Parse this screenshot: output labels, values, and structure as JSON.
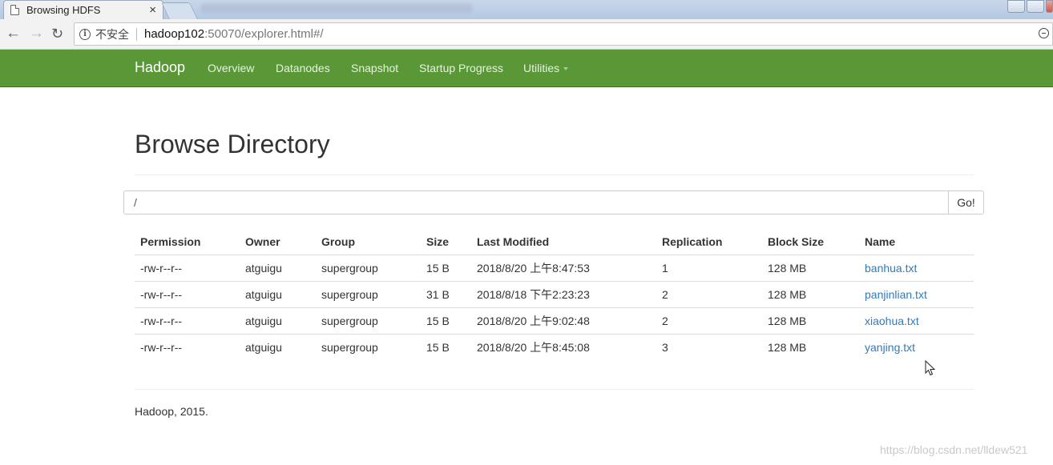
{
  "browser": {
    "tab_title": "Browsing HDFS",
    "tab_close": "×",
    "insecure_label": "不安全",
    "url_host": "hadoop102",
    "url_rest": ":50070/explorer.html#/"
  },
  "navbar": {
    "brand": "Hadoop",
    "items": [
      "Overview",
      "Datanodes",
      "Snapshot",
      "Startup Progress",
      "Utilities"
    ]
  },
  "page": {
    "title": "Browse Directory",
    "path_value": "/",
    "go_label": "Go!"
  },
  "table": {
    "headers": [
      "Permission",
      "Owner",
      "Group",
      "Size",
      "Last Modified",
      "Replication",
      "Block Size",
      "Name"
    ],
    "rows": [
      [
        "-rw-r--r--",
        "atguigu",
        "supergroup",
        "15 B",
        "2018/8/20 上午8:47:53",
        "1",
        "128 MB",
        "banhua.txt"
      ],
      [
        "-rw-r--r--",
        "atguigu",
        "supergroup",
        "31 B",
        "2018/8/18 下午2:23:23",
        "2",
        "128 MB",
        "panjinlian.txt"
      ],
      [
        "-rw-r--r--",
        "atguigu",
        "supergroup",
        "15 B",
        "2018/8/20 上午9:02:48",
        "2",
        "128 MB",
        "xiaohua.txt"
      ],
      [
        "-rw-r--r--",
        "atguigu",
        "supergroup",
        "15 B",
        "2018/8/20 上午8:45:08",
        "3",
        "128 MB",
        "yanjing.txt"
      ]
    ]
  },
  "footer": "Hadoop, 2015.",
  "watermark": "https://blog.csdn.net/lldew521",
  "colors": {
    "navbar": "#5a9737",
    "link": "#337ab7"
  }
}
